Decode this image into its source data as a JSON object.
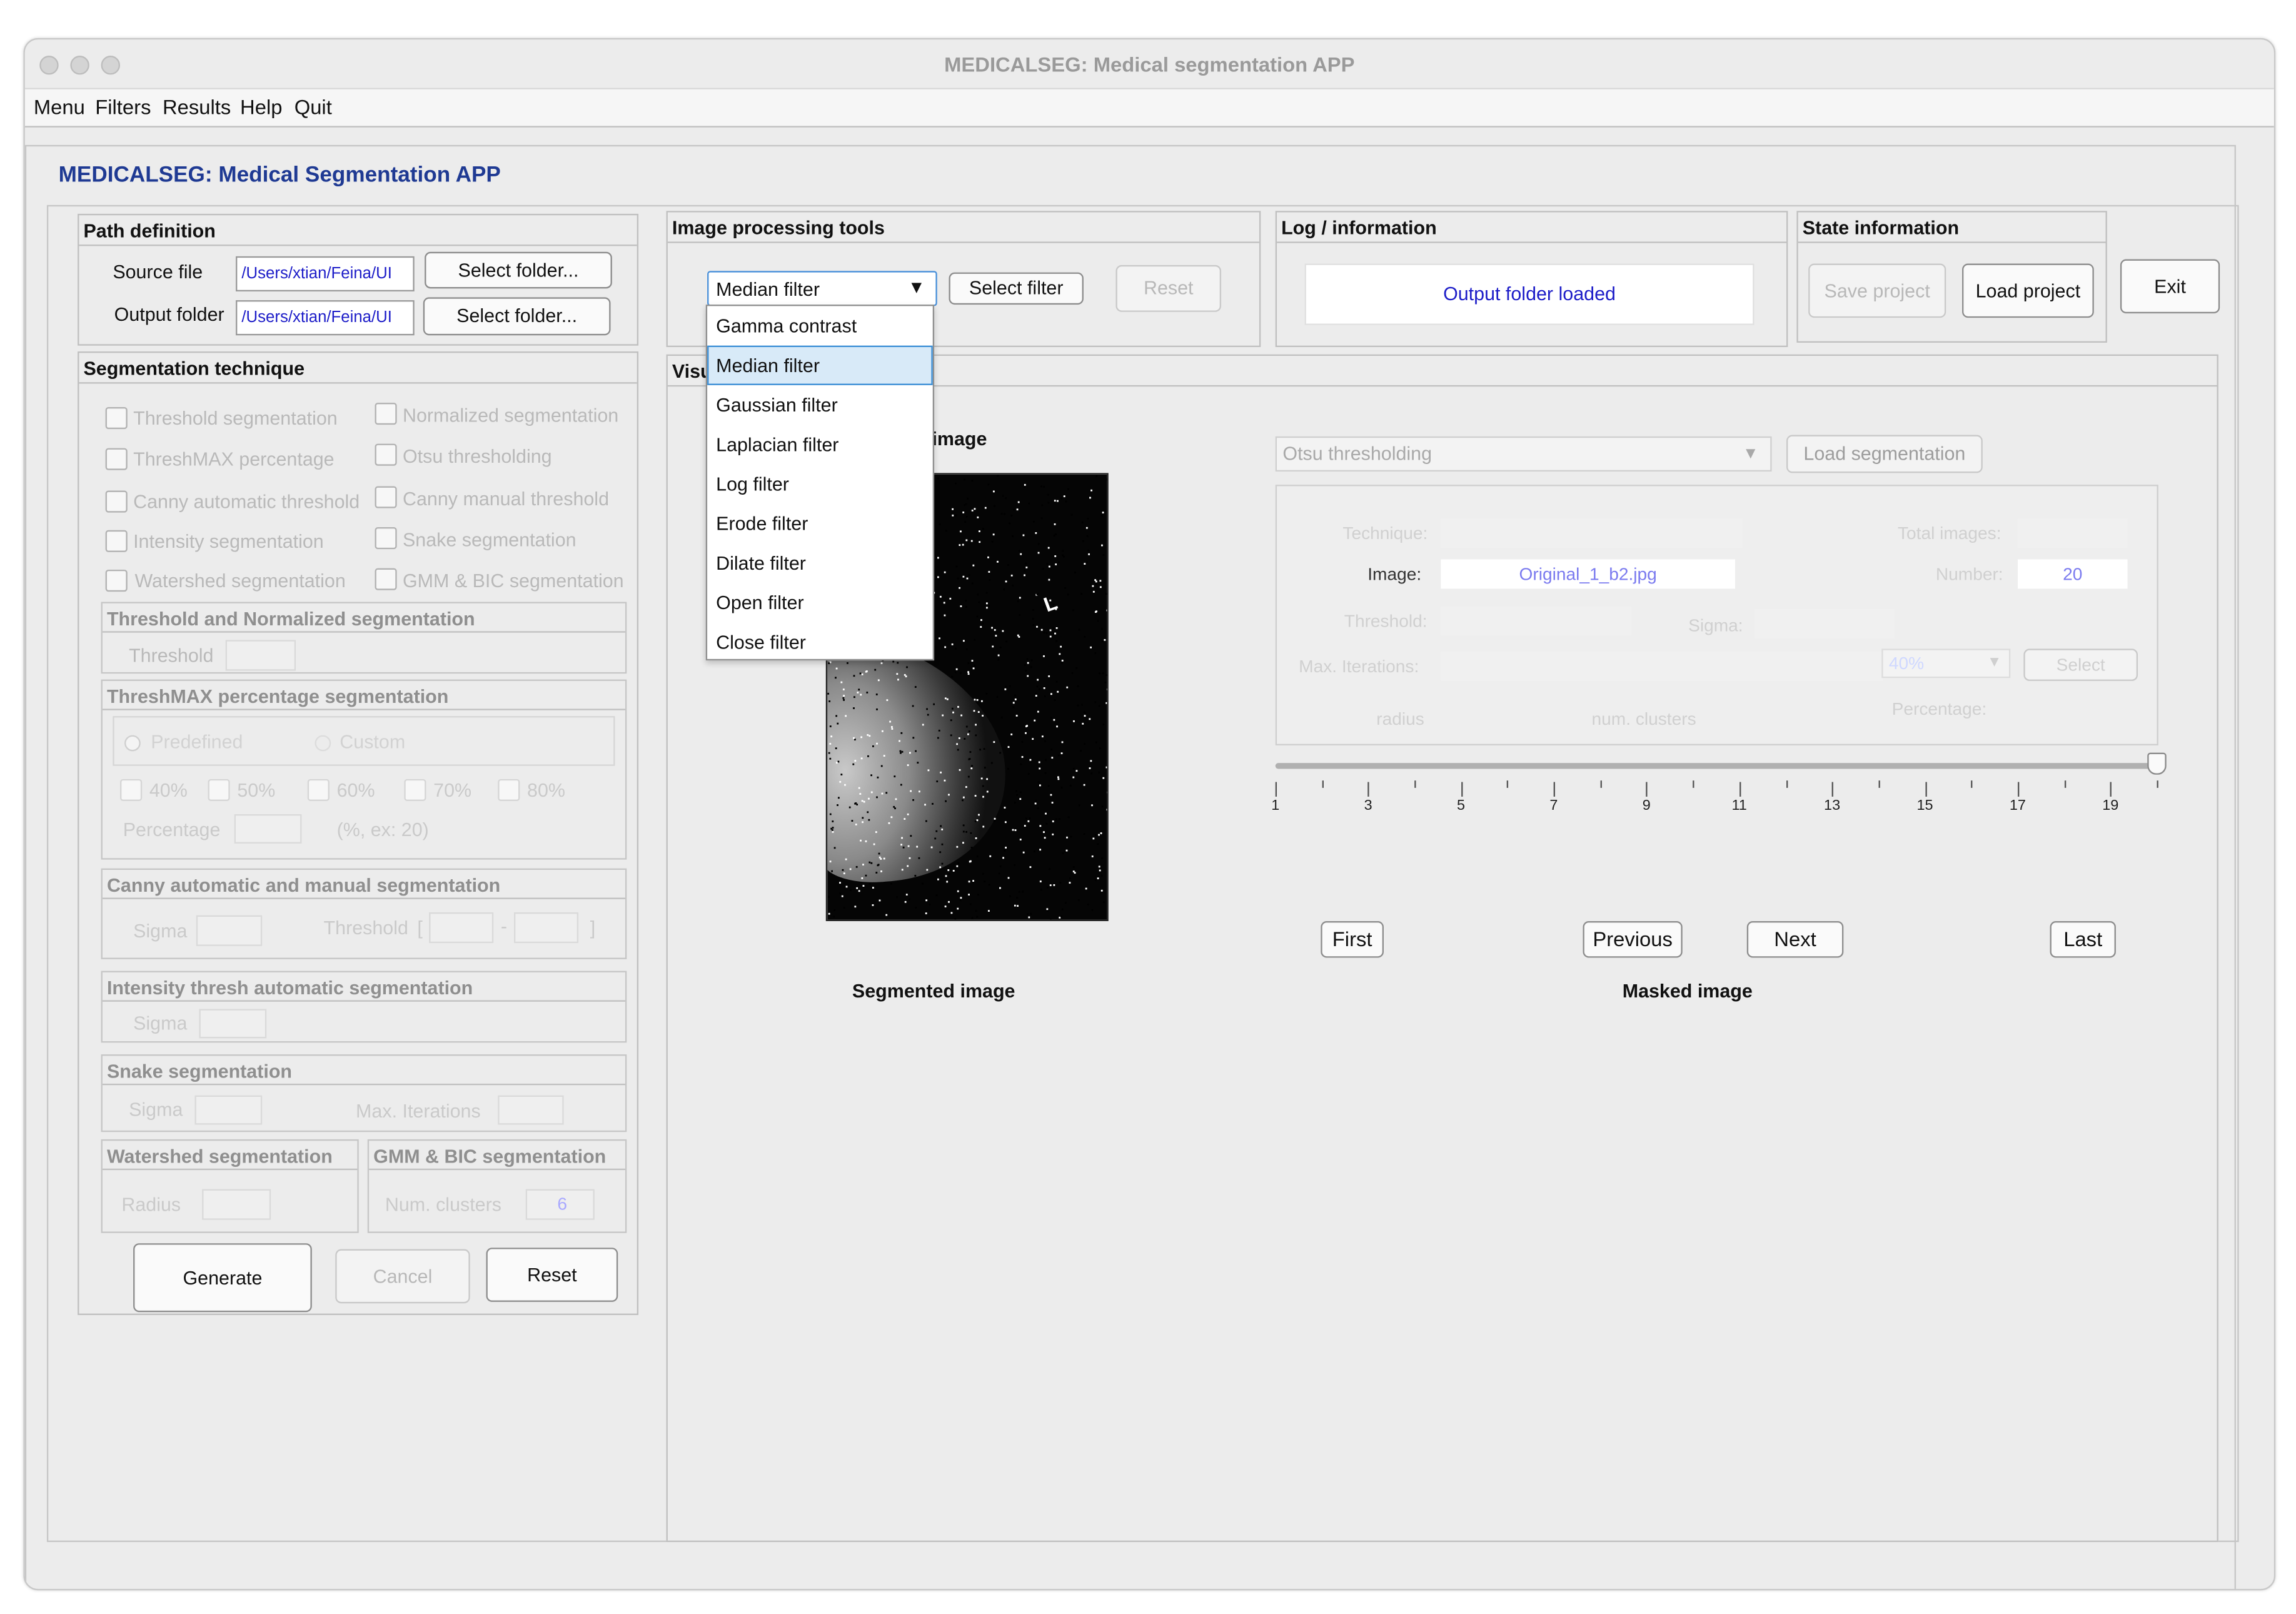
{
  "window": {
    "title": "MEDICALSEG: Medical segmentation APP"
  },
  "menu": [
    "Menu",
    "Filters",
    "Results",
    "Help",
    "Quit"
  ],
  "app_heading": "MEDICALSEG: Medical Segmentation APP",
  "path": {
    "title": "Path definition",
    "source_label": "Source file",
    "source_value": "/Users/xtian/Feina/UI",
    "output_label": "Output folder",
    "output_value": "/Users/xtian/Feina/UI",
    "select_folder": "Select folder..."
  },
  "seg": {
    "title": "Segmentation technique",
    "checks": [
      "Threshold segmentation",
      "Normalized segmentation",
      "ThreshMAX percentage",
      "Otsu thresholding",
      "Canny automatic threshold",
      "Canny manual threshold",
      "Intensity segmentation",
      "Snake segmentation",
      "Watershed segmentation",
      "GMM & BIC segmentation"
    ],
    "thr_norm": {
      "title": "Threshold and Normalized segmentation",
      "threshold": "Threshold"
    },
    "threshmax": {
      "title": "ThreshMAX percentage segmentation",
      "predefined": "Predefined",
      "custom": "Custom",
      "pcts": [
        "40%",
        "50%",
        "60%",
        "70%",
        "80%"
      ],
      "percentage": "Percentage",
      "hint": "(%, ex: 20)"
    },
    "canny": {
      "title": "Canny automatic and manual segmentation",
      "sigma": "Sigma",
      "threshold": "Threshold",
      "lb": "[",
      "sep": "-",
      "rb": "]"
    },
    "intensity": {
      "title": "Intensity thresh automatic segmentation",
      "sigma": "Sigma"
    },
    "snake": {
      "title": "Snake segmentation",
      "sigma": "Sigma",
      "maxit": "Max. Iterations"
    },
    "watershed": {
      "title": "Watershed segmentation",
      "radius": "Radius"
    },
    "gmm": {
      "title": "GMM & BIC segmentation",
      "clusters": "Num. clusters",
      "clusters_value": "6"
    },
    "buttons": {
      "generate": "Generate",
      "cancel": "Cancel",
      "reset": "Reset"
    }
  },
  "tools": {
    "title": "Image processing tools",
    "selected": "Median filter",
    "select_filter": "Select filter",
    "reset": "Reset",
    "options": [
      "Gamma contrast",
      "Median filter",
      "Gaussian filter",
      "Laplacian filter",
      "Log filter",
      "Erode filter",
      "Dilate filter",
      "Open filter",
      "Close filter"
    ],
    "selected_index": 1
  },
  "log": {
    "title": "Log / information",
    "message": "Output folder loaded"
  },
  "state": {
    "title": "State information",
    "save": "Save project",
    "load": "Load project"
  },
  "exit": "Exit",
  "vis": {
    "title_partial": "Visu",
    "orig_partial": "al image",
    "segmented": "Segmented image",
    "masked": "Masked image",
    "method": "Otsu thresholding",
    "load_seg": "Load segmentation",
    "info": {
      "technique": "Technique:",
      "image": "Image:",
      "image_value": "Original_1_b2.jpg",
      "threshold": "Threshold:",
      "sigma": "Sigma:",
      "maxit": "Max. Iterations:",
      "radius": "radius",
      "clusters": "num. clusters",
      "total": "Total images:",
      "number": "Number:",
      "number_value": "20",
      "pct_value": "40%",
      "select": "Select",
      "percentage": "Percentage:"
    },
    "slider": {
      "min": 1,
      "max": 20,
      "value": 20,
      "labels": [
        "1",
        "3",
        "5",
        "7",
        "9",
        "11",
        "13",
        "15",
        "17",
        "19"
      ]
    },
    "nav": {
      "first": "First",
      "previous": "Previous",
      "next": "Next",
      "last": "Last"
    }
  },
  "colors": {
    "accent": "#1f3a93",
    "link": "#1d1dc8"
  }
}
